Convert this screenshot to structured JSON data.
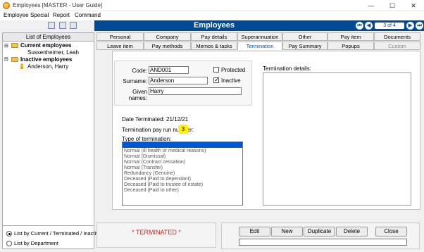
{
  "window": {
    "title": "Employees [MASTER - User Guide]",
    "controls": [
      "—",
      "☐",
      "✕"
    ]
  },
  "menu": [
    "Employee",
    "Special",
    "Report",
    "Command"
  ],
  "header": {
    "title": "Employees",
    "record": "3 of 4"
  },
  "left_panel": {
    "heading": "List of Employees",
    "groups": [
      {
        "label": "Current employees",
        "items": [
          "Sussenheimer, Leah"
        ]
      },
      {
        "label": "Inactive employees",
        "items": [
          "Anderson, Harry"
        ]
      }
    ],
    "radio_options": [
      "List by Current / Terminated / Inactive",
      "List by Department"
    ]
  },
  "tabs_row1": [
    "Personal",
    "Company",
    "Pay details",
    "Superannuation",
    "Other",
    "Pay item",
    "Documents"
  ],
  "tabs_row2": [
    "Leave item",
    "Pay methods",
    "Memos & tasks",
    "Termination",
    "Pay Summary",
    "Popups",
    "Custom"
  ],
  "active_tab": "Termination",
  "form": {
    "code_label": "Code:",
    "code_value": "AND001",
    "surname_label": "Surname:",
    "surname_value": "Anderson",
    "given_label": "Given names:",
    "given_value": "Harry",
    "protected_label": "Protected",
    "inactive_label": "Inactive"
  },
  "termination": {
    "date_text": "Date Terminated: 21/12/21",
    "run_label": "Termination pay run number:",
    "run_value": "3",
    "type_label": "Type of termination:",
    "types": [
      "Normal (Ill health or medical reasons)",
      "Normal (Dismissal)",
      "Normal (Contract cessation)",
      "Normal (Transfer)",
      "Redundancy (Genuine)",
      "Deceased (Paid to dependant)",
      "Deceased (Paid to trustee of estate)",
      "Deceased (Paid to other)"
    ],
    "details_label": "Termination details:"
  },
  "status": "* TERMINATED *",
  "buttons": [
    "Edit",
    "New",
    "Duplicate",
    "Delete",
    "Close"
  ],
  "colors": {
    "header": "#004a93",
    "accent": "#0055b8",
    "status": "#e02020",
    "highlight": "#fff200"
  }
}
